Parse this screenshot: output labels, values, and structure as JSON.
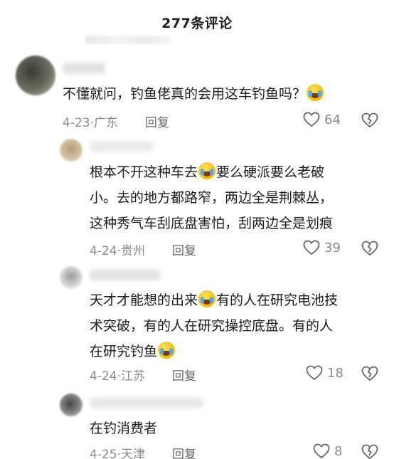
{
  "header": {
    "title": "277条评论"
  },
  "comments": [
    {
      "text_lines": [
        "不懂就问，钓鱼佬真的会用这车钓鱼吗？"
      ],
      "date": "4-23",
      "location": "广东",
      "reply_label": "回复",
      "likes": "64",
      "emoji": "face-with-tears-of-joy-icon"
    },
    {
      "text_lines": [
        "根本不开这种车去",
        "要么硬派要么老破",
        "小。去的地方都路窄，两边全是荆棘丛，",
        "这种秀气车刮底盘害怕，刮两边全是划痕"
      ],
      "date": "4-24",
      "location": "贵州",
      "reply_label": "回复",
      "likes": "39",
      "emoji": "loudly-crying-face-icon"
    },
    {
      "text_lines": [
        "天才才能想的出来",
        "有的人在研究电池技",
        "术突破，有的人在研究操控底盘。有的人",
        "在研究钓鱼"
      ],
      "date": "4-24",
      "location": "江苏",
      "reply_label": "回复",
      "likes": "18",
      "emoji": "face-with-tears-of-joy-icon"
    },
    {
      "text_lines": [
        "在钓消费者"
      ],
      "date": "4-25",
      "location": "天津",
      "reply_label": "回复",
      "likes": "8"
    }
  ],
  "colors": {
    "text": "#1c1c1c",
    "meta": "#8b8b8b",
    "reply": "#666666"
  }
}
